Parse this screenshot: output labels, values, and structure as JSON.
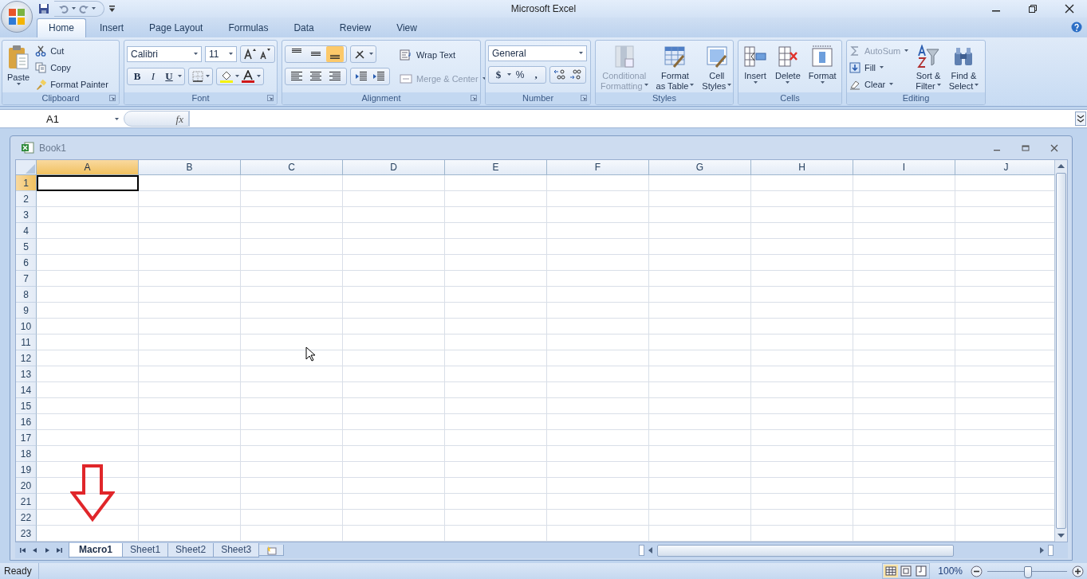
{
  "window": {
    "title": "Microsoft Excel"
  },
  "tabs": [
    {
      "label": "Home",
      "selected": true
    },
    {
      "label": "Insert",
      "selected": false
    },
    {
      "label": "Page Layout",
      "selected": false
    },
    {
      "label": "Formulas",
      "selected": false
    },
    {
      "label": "Data",
      "selected": false
    },
    {
      "label": "Review",
      "selected": false
    },
    {
      "label": "View",
      "selected": false
    }
  ],
  "clipboard": {
    "title": "Clipboard",
    "paste": "Paste",
    "cut": "Cut",
    "copy": "Copy",
    "format_painter": "Format Painter"
  },
  "font": {
    "title": "Font",
    "name": "Calibri",
    "size": "11",
    "bold": "B",
    "italic": "I",
    "underline": "U"
  },
  "alignment": {
    "title": "Alignment",
    "vertical": [
      {
        "selected": false
      },
      {
        "selected": false
      },
      {
        "selected": true
      }
    ],
    "wrap_text": {
      "label": "Wrap Text",
      "disabled": false
    },
    "merge_center": {
      "label": "Merge & Center",
      "disabled": true
    }
  },
  "number": {
    "title": "Number",
    "format": "General",
    "currency": "$",
    "percent": "%",
    "comma": ","
  },
  "styles": {
    "title": "Styles",
    "buttons": [
      {
        "lines": [
          "Conditional",
          "Formatting"
        ],
        "disabled": true
      },
      {
        "lines": [
          "Format",
          "as Table"
        ],
        "disabled": false
      },
      {
        "lines": [
          "Cell",
          "Styles"
        ],
        "disabled": false
      }
    ]
  },
  "cells": {
    "title": "Cells",
    "buttons": [
      "Insert",
      "Delete",
      "Format"
    ]
  },
  "editing": {
    "title": "Editing",
    "small": [
      {
        "label": "AutoSum",
        "disabled": true
      },
      {
        "label": "Fill",
        "disabled": false
      },
      {
        "label": "Clear",
        "disabled": false
      }
    ],
    "large": [
      {
        "lines": [
          "Sort &",
          "Filter"
        ]
      },
      {
        "lines": [
          "Find &",
          "Select"
        ]
      }
    ]
  },
  "formula_bar": {
    "name_box": "A1",
    "function_label": "fx"
  },
  "workbook": {
    "title": "Book1",
    "columns": [
      {
        "label": "A",
        "selected": true
      },
      {
        "label": "B",
        "selected": false
      },
      {
        "label": "C",
        "selected": false
      },
      {
        "label": "D",
        "selected": false
      },
      {
        "label": "E",
        "selected": false
      },
      {
        "label": "F",
        "selected": false
      },
      {
        "label": "G",
        "selected": false
      },
      {
        "label": "H",
        "selected": false
      },
      {
        "label": "I",
        "selected": false
      },
      {
        "label": "J",
        "selected": false
      }
    ],
    "rows": [
      {
        "label": "1",
        "selected": true
      },
      {
        "label": "2",
        "selected": false
      },
      {
        "label": "3",
        "selected": false
      },
      {
        "label": "4",
        "selected": false
      },
      {
        "label": "5",
        "selected": false
      },
      {
        "label": "6",
        "selected": false
      },
      {
        "label": "7",
        "selected": false
      },
      {
        "label": "8",
        "selected": false
      },
      {
        "label": "9",
        "selected": false
      },
      {
        "label": "10",
        "selected": false
      },
      {
        "label": "11",
        "selected": false
      },
      {
        "label": "12",
        "selected": false
      },
      {
        "label": "13",
        "selected": false
      },
      {
        "label": "14",
        "selected": false
      },
      {
        "label": "15",
        "selected": false
      },
      {
        "label": "16",
        "selected": false
      },
      {
        "label": "17",
        "selected": false
      },
      {
        "label": "18",
        "selected": false
      },
      {
        "label": "19",
        "selected": false
      },
      {
        "label": "20",
        "selected": false
      },
      {
        "label": "21",
        "selected": false
      },
      {
        "label": "22",
        "selected": false
      },
      {
        "label": "23",
        "selected": false
      }
    ]
  },
  "sheet_tabs": [
    {
      "label": "Macro1",
      "selected": true
    },
    {
      "label": "Sheet1",
      "selected": false
    },
    {
      "label": "Sheet2",
      "selected": false
    },
    {
      "label": "Sheet3",
      "selected": false
    }
  ],
  "status_bar": {
    "status": "Ready",
    "views": [
      {
        "selected": true
      },
      {
        "selected": false
      },
      {
        "selected": false
      }
    ],
    "zoom": "100%",
    "zoom_slider": {
      "level": 0.5
    }
  }
}
